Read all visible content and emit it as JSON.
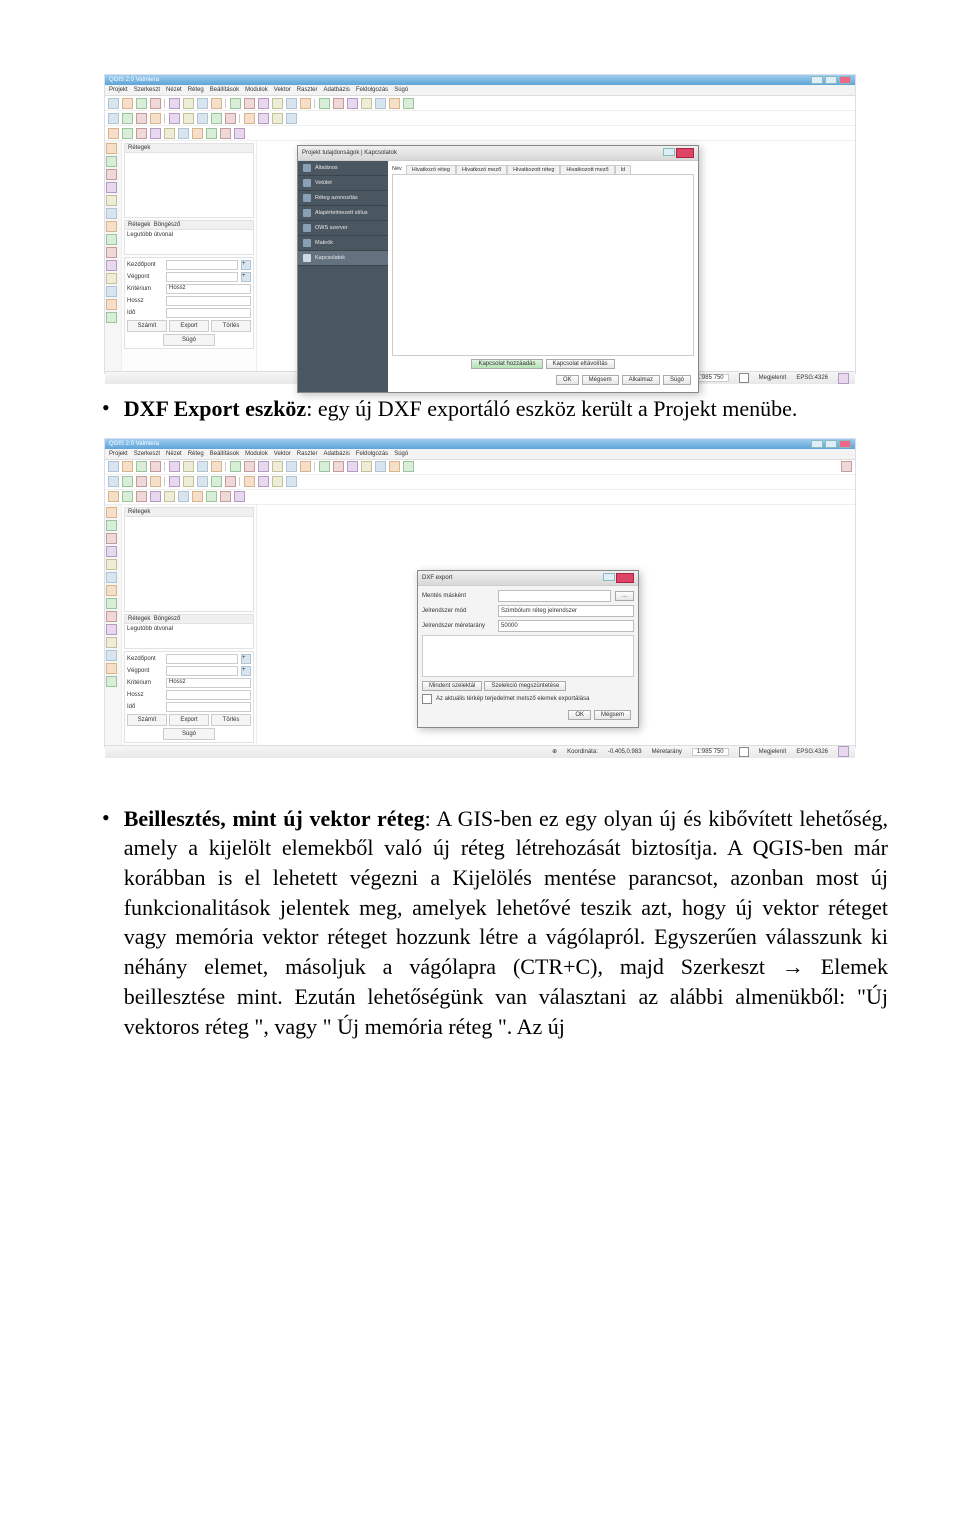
{
  "qgis": {
    "title": "QGIS 2.0 Valmiera",
    "menus": [
      "Projekt",
      "Szerkeszt",
      "Nézet",
      "Réteg",
      "Beállítások",
      "Modulok",
      "Vektor",
      "Raszter",
      "Adatbázis",
      "Feldolgozás",
      "Súgó"
    ],
    "panels": {
      "layers_hdr": "Rétegek",
      "browse_hdr": "Böngésző",
      "recent_label": "Legutóbb útvonal",
      "start_label": "Kezdőpont",
      "end_label": "Végpont",
      "criteria_label": "Kritérium",
      "criteria_value": "Hossz",
      "length_label": "Hossz",
      "time_label": "Idő",
      "btn_calc": "Számít",
      "btn_export": "Export",
      "btn_clear": "Törlés",
      "btn_help": "Súgó"
    },
    "status": {
      "coord_label": "Koordináta:",
      "coord_value": "-0.405,0.983",
      "scale_label": "Méretarány",
      "scale_value": "1:985 750",
      "render_label": "Megjelenít",
      "crs": "EPSG:4326"
    }
  },
  "dialog_props": {
    "title": "Projekt tulajdonságok | Kapcsolatok",
    "side": [
      "Általános",
      "Vetület",
      "Réteg azonosítás",
      "Alapértelmezett stílus",
      "OWS szerver",
      "Makrók",
      "Kapcsolatok"
    ],
    "tabrow_label": "Név",
    "tabs": [
      "Hivatkozó réteg",
      "Hivatkozó mező",
      "Hivatkozott réteg",
      "Hivatkozott mező",
      "Id"
    ],
    "btn_add": "Kapcsolat hozzáadás",
    "btn_remove": "Kapcsolat eltávolítás",
    "btn_ok": "OK",
    "btn_cancel": "Mégsem",
    "btn_apply": "Alkalmaz",
    "btn_help": "Súgó"
  },
  "dialog_dxf": {
    "title": "DXF export",
    "saveas_label": "Mentés másként",
    "symmode_label": "Jelrendszer mód",
    "symmode_value": "Szimbólum réteg jelrendszer",
    "scale_label": "Jelrendszer méretarány",
    "scale_value": "50000",
    "btn_selectall": "Mindent szelektál",
    "btn_unselect": "Szelekció megszüntetése",
    "chk_extent": "Az aktuális térkép terjedelmet metsző elemek exportálása",
    "btn_ok": "OK",
    "btn_cancel": "Mégsem"
  },
  "doc": {
    "b1_bold": "DXF Export eszköz",
    "b1_rest": ": egy új DXF exportáló eszköz került a Projekt menübe.",
    "b2_bold": "Beillesztés, mint új vektor réteg",
    "b2_rest": ": A GIS-ben ez egy olyan új és kibővített lehetőség, amely a kijelölt elemekből való új réteg létrehozását biztosítja. A QGIS-ben már korábban is el lehetett végezni a Kijelölés mentése parancsot, azonban most új  funkcionalitások jelentek meg, amelyek lehetővé teszik azt, hogy új vektor réteget vagy memória vektor réteget hozzunk létre a vágólapról. Egyszerűen válasszunk ki néhány elemet, másoljuk a vágólapra (CTR+C), majd Szerkeszt → Elemek beillesztése mint. Ezután lehetőségünk van választani az alábbi almenükből: \"Új vektoros réteg \", vagy \" Új memória réteg \". Az új"
  }
}
